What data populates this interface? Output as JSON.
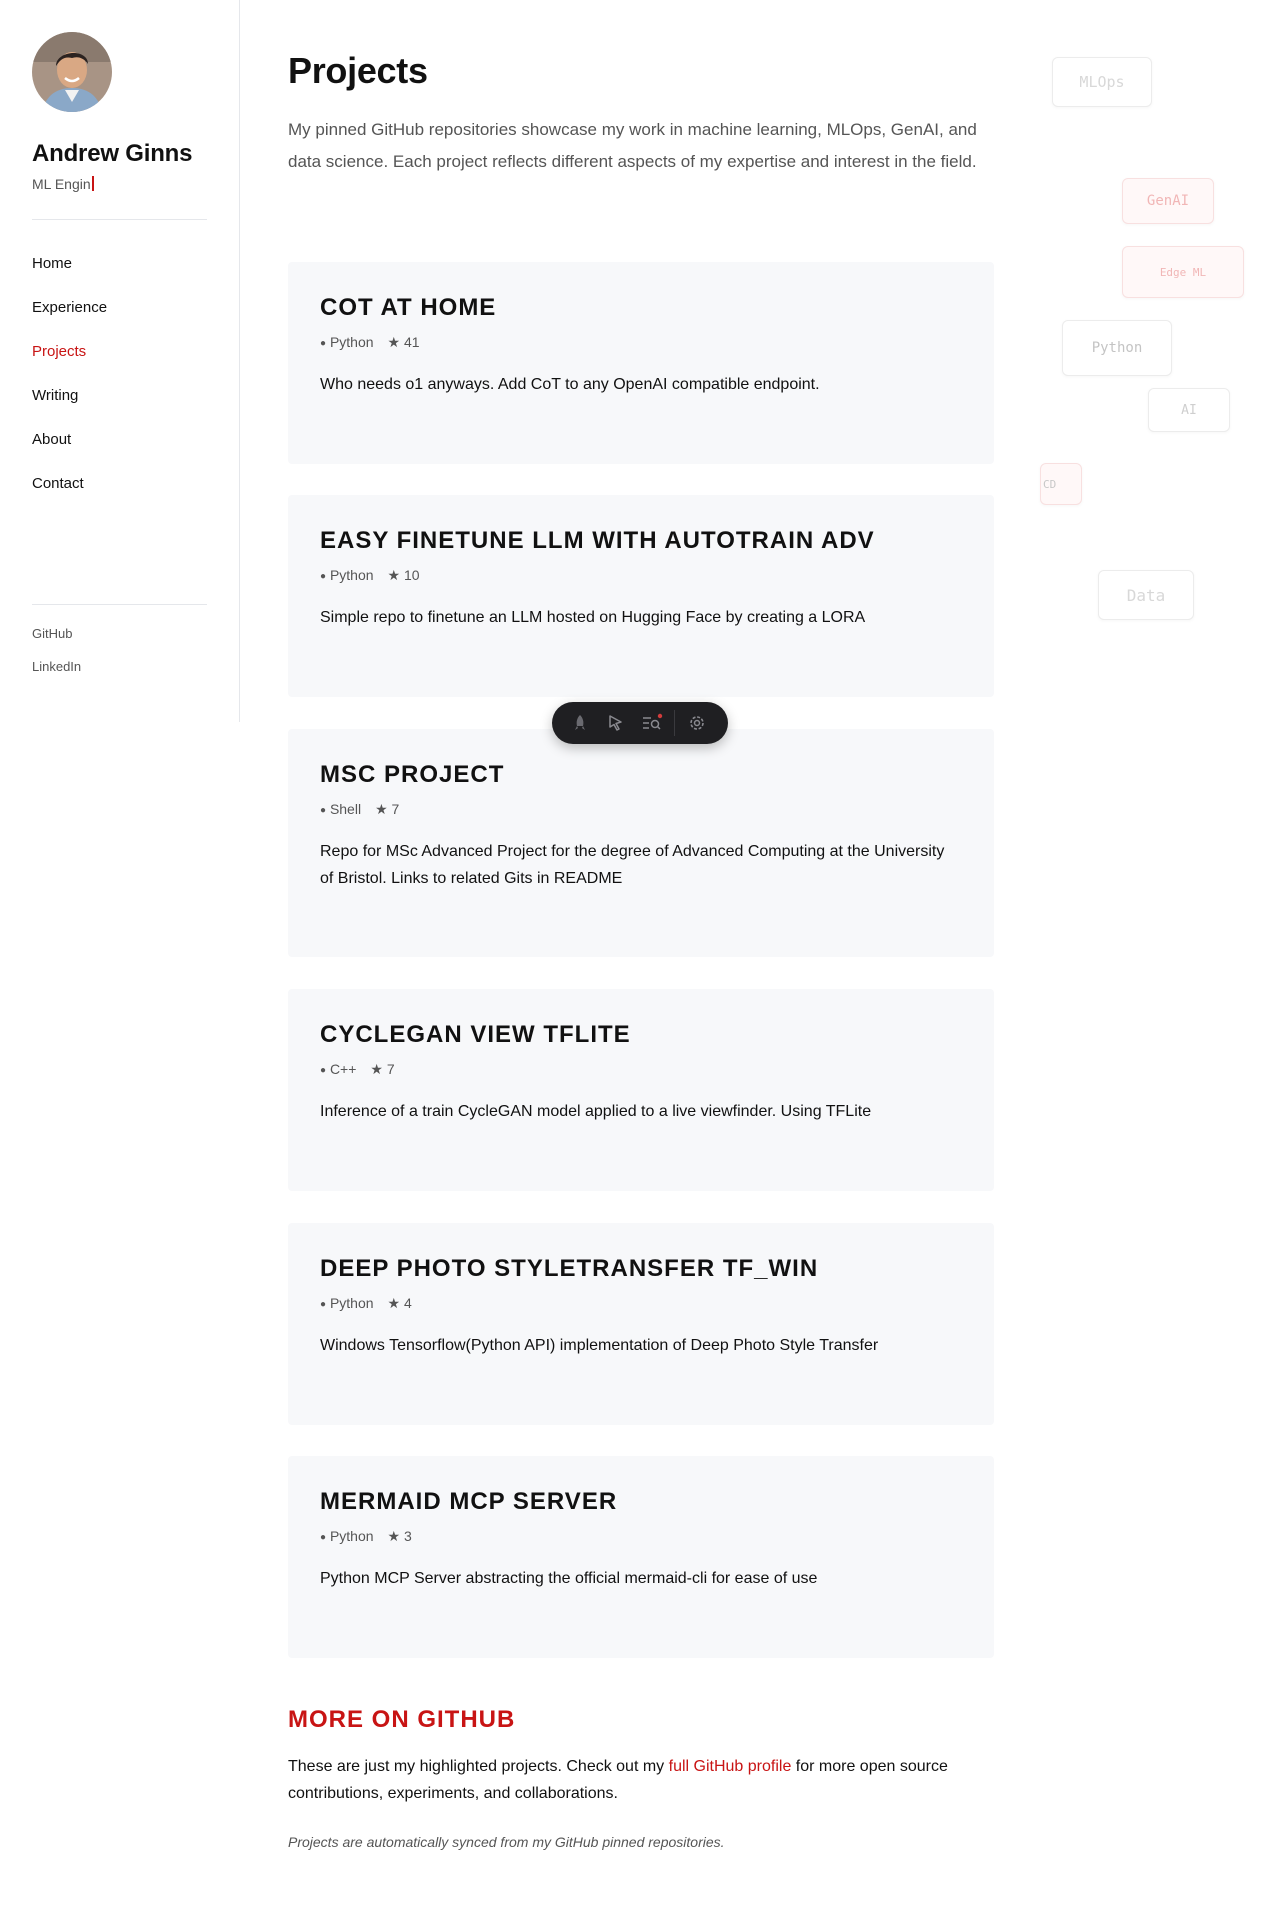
{
  "profile": {
    "name": "Andrew Ginns",
    "role": "ML Engin"
  },
  "nav": {
    "items": [
      {
        "label": "Home",
        "active": false
      },
      {
        "label": "Experience",
        "active": false
      },
      {
        "label": "Projects",
        "active": true
      },
      {
        "label": "Writing",
        "active": false
      },
      {
        "label": "About",
        "active": false
      },
      {
        "label": "Contact",
        "active": false
      }
    ]
  },
  "social": {
    "github": "GitHub",
    "linkedin": "LinkedIn"
  },
  "page": {
    "title": "Projects",
    "intro": "My pinned GitHub repositories showcase my work in machine learning, MLOps, GenAI, and data science. Each project reflects different aspects of my expertise and interest in the field."
  },
  "projects": [
    {
      "title": "COT AT HOME",
      "language": "Python",
      "stars": "★ 41",
      "description": "Who needs o1 anyways. Add CoT to any OpenAI compatible endpoint."
    },
    {
      "title": "EASY FINETUNE LLM WITH AUTOTRAIN ADV",
      "language": "Python",
      "stars": "★ 10",
      "description": "Simple repo to finetune an LLM hosted on Hugging Face by creating a LORA"
    },
    {
      "title": "MSC PROJECT",
      "language": "Shell",
      "stars": "★ 7",
      "description": "Repo for MSc Advanced Project for the degree of Advanced Computing at the University of Bristol. Links to related Gits in README"
    },
    {
      "title": "CYCLEGAN VIEW TFLITE",
      "language": "C++",
      "stars": "★ 7",
      "description": "Inference of a train CycleGAN model applied to a live viewfinder. Using TFLite"
    },
    {
      "title": "DEEP PHOTO STYLETRANSFER TF_WIN",
      "language": "Python",
      "stars": "★ 4",
      "description": "Windows Tensorflow(Python API) implementation of Deep Photo Style Transfer"
    },
    {
      "title": "MERMAID MCP SERVER",
      "language": "Python",
      "stars": "★ 3",
      "description": "Python MCP Server abstracting the official mermaid-cli for ease of use"
    }
  ],
  "more": {
    "title": "MORE ON GITHUB",
    "text_before": "These are just my highlighted projects. Check out my ",
    "link": "full GitHub profile",
    "text_after": " for more open source contributions, experiments, and collaborations.",
    "footnote": "Projects are automatically synced from my GitHub pinned repositories."
  },
  "floating_tags": [
    "MLOps",
    "GenAI",
    "Edge ML",
    "Python",
    "AI",
    "CD",
    "Data"
  ],
  "toolbar": {
    "icons": [
      "rocket-icon",
      "cursor-select-icon",
      "search-list-icon",
      "gear-icon"
    ]
  },
  "colors": {
    "accent": "#c81414",
    "card_bg": "#f7f8fa",
    "muted_text": "#555555",
    "toolbar_bg": "#1f1f22"
  }
}
